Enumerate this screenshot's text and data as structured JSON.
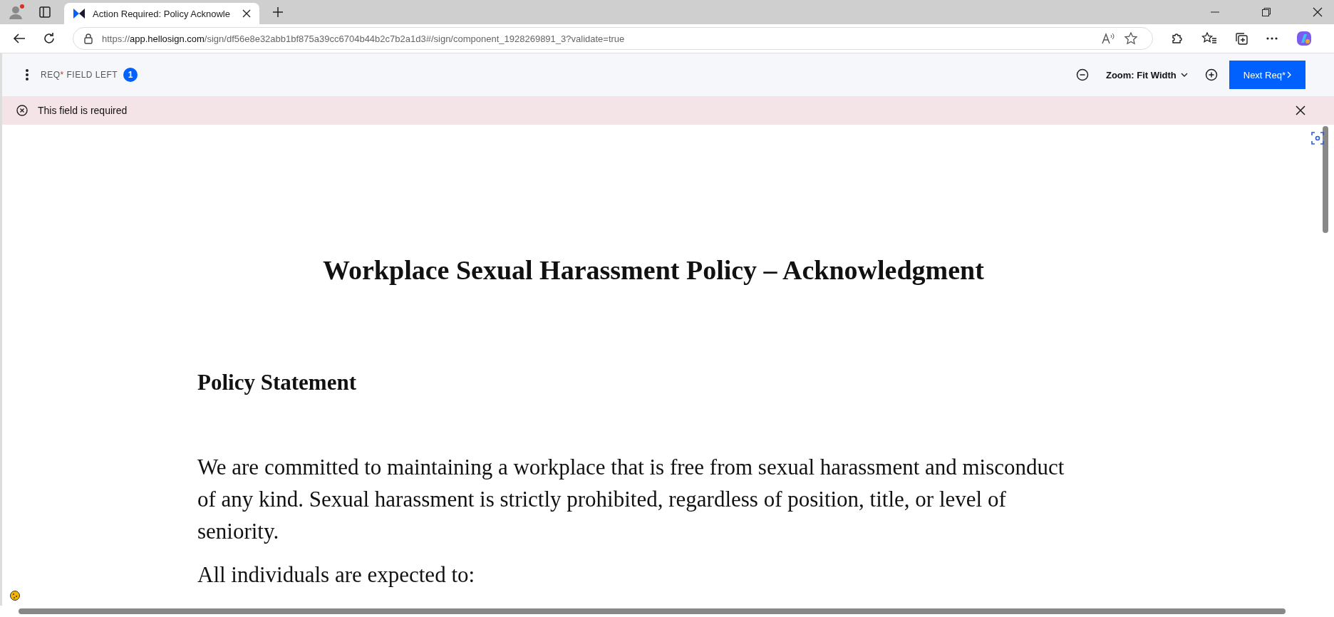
{
  "browser": {
    "tab": {
      "title": "Action Required: Policy Acknowle",
      "selected": true
    },
    "url": {
      "scheme": "https://",
      "host": "app.hellosign.com",
      "path": "/sign/df56e8e32abb1bf875a39cc6704b44b2c7b2a1d3#/sign/component_1928269891_3?validate=true"
    }
  },
  "toolbar": {
    "required_label": "REQ",
    "required_mark": "*",
    "fields_left_label": " FIELD LEFT",
    "fields_left_count": "1",
    "zoom_label": "Zoom: Fit Width",
    "next_button": "Next Req*"
  },
  "alert": {
    "message": "This field is required"
  },
  "document": {
    "title": "Workplace Sexual Harassment Policy – Acknowledgment",
    "heading": "Policy Statement",
    "paragraphs": [
      "We are committed to maintaining a workplace that is free from sexual harassment and misconduct of any kind. Sexual harassment is strictly prohibited, regardless of position, title, or level of seniority.",
      "All individuals are expected to:"
    ]
  }
}
